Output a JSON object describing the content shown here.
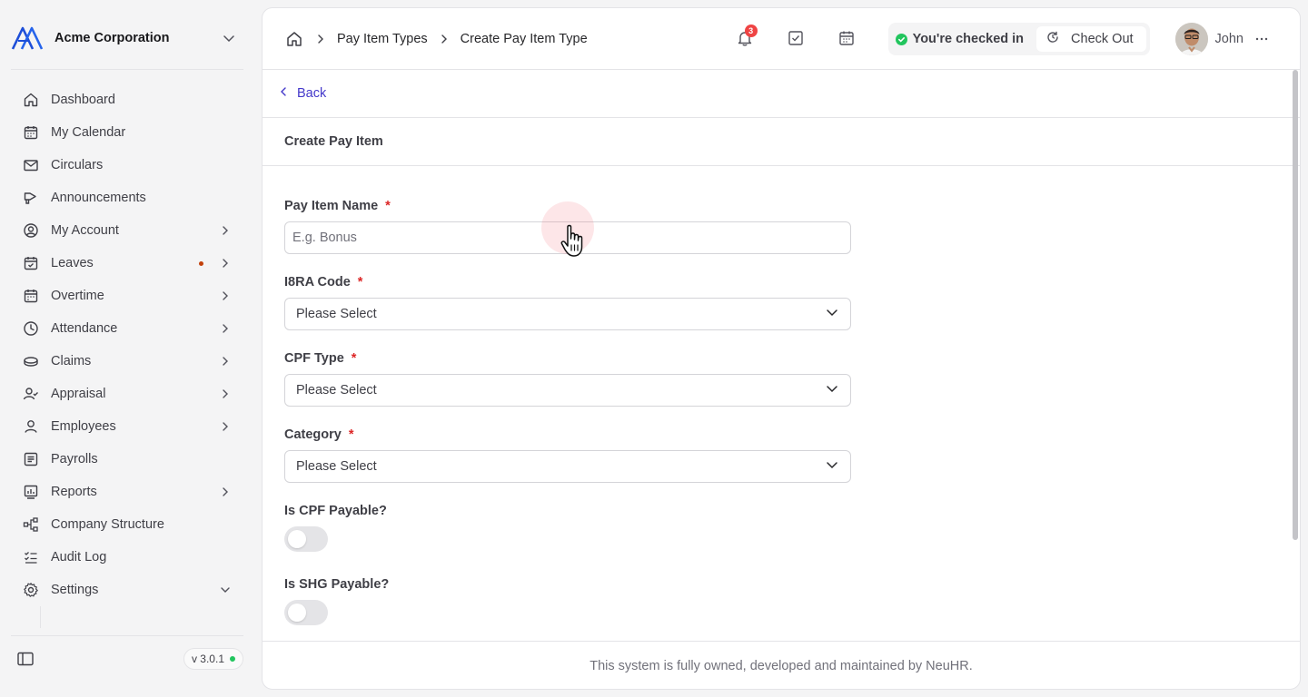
{
  "sidebar": {
    "org_name": "Acme Corporation",
    "items": [
      {
        "label": "Dashboard",
        "icon": "home-icon"
      },
      {
        "label": "My Calendar",
        "icon": "calendar-icon"
      },
      {
        "label": "Circulars",
        "icon": "mail-icon"
      },
      {
        "label": "Announcements",
        "icon": "megaphone-icon"
      },
      {
        "label": "My Account",
        "icon": "user-circle-icon"
      },
      {
        "label": "Leaves",
        "icon": "calendar-check-icon"
      },
      {
        "label": "Overtime",
        "icon": "calendar-icon"
      },
      {
        "label": "Attendance",
        "icon": "clock-icon"
      },
      {
        "label": "Claims",
        "icon": "coins-icon"
      },
      {
        "label": "Appraisal",
        "icon": "user-check-icon"
      },
      {
        "label": "Employees",
        "icon": "user-icon"
      },
      {
        "label": "Payrolls",
        "icon": "receipt-icon"
      },
      {
        "label": "Reports",
        "icon": "chart-icon"
      },
      {
        "label": "Company Structure",
        "icon": "hierarchy-icon"
      },
      {
        "label": "Audit Log",
        "icon": "checklist-icon"
      },
      {
        "label": "Settings",
        "icon": "gear-icon"
      }
    ],
    "version": "v 3.0.1"
  },
  "header": {
    "breadcrumbs": [
      "Pay Item Types",
      "Create Pay Item Type"
    ],
    "notification_count": "3",
    "checkin_status": "You're checked in",
    "checkout_label": "Check Out",
    "user_name": "John"
  },
  "page": {
    "back_label": "Back",
    "form_title": "Create Pay Item",
    "fields": {
      "pay_item_name": {
        "label": "Pay Item Name",
        "required": "*",
        "placeholder": "E.g. Bonus",
        "value": ""
      },
      "ir8a_code": {
        "label": "I8RA Code",
        "required": "*",
        "value": "Please Select"
      },
      "cpf_type": {
        "label": "CPF Type",
        "required": "*",
        "value": "Please Select"
      },
      "category": {
        "label": "Category",
        "required": "*",
        "value": "Please Select"
      },
      "is_cpf_payable": {
        "label": "Is CPF Payable?",
        "checked": false
      },
      "is_shg_payable": {
        "label": "Is SHG Payable?",
        "checked": false
      }
    }
  },
  "footer": {
    "text": "This system is fully owned, developed and maintained by NeuHR."
  },
  "colors": {
    "accent": "#4338ca",
    "required": "#dc2626",
    "status_green": "#22c55e",
    "badge_red": "#ef4444"
  }
}
